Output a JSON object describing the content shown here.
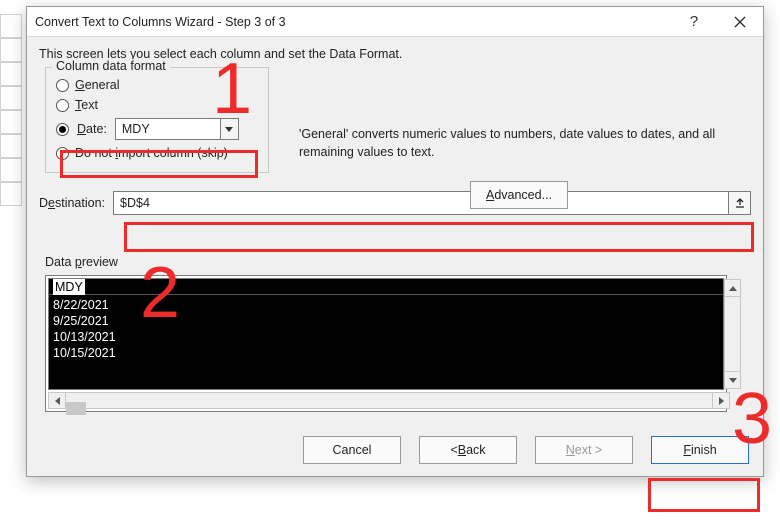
{
  "annotations": {
    "n1": "1",
    "n2": "2",
    "n3": "3"
  },
  "dialog": {
    "title": "Convert Text to Columns Wizard - Step 3 of 3",
    "intro": "This screen lets you select each column and set the Data Format.",
    "column_format": {
      "legend": "Column data format",
      "general": "General",
      "text": "Text",
      "date": "Date:",
      "date_format": "MDY",
      "skip": "Do not import column (skip)"
    },
    "right": {
      "desc": "'General' converts numeric values to numbers, date values to dates, and all remaining values to text.",
      "advanced": "Advanced..."
    },
    "destination": {
      "label": "Destination:",
      "value": "$D$4"
    },
    "preview": {
      "label": "Data preview",
      "header_selected": "MDY",
      "rows": [
        "8/22/2021",
        "9/25/2021",
        "10/13/2021",
        "10/15/2021"
      ]
    },
    "footer": {
      "cancel": "Cancel",
      "back": "< Back",
      "next": "Next >",
      "finish": "Finish"
    }
  }
}
